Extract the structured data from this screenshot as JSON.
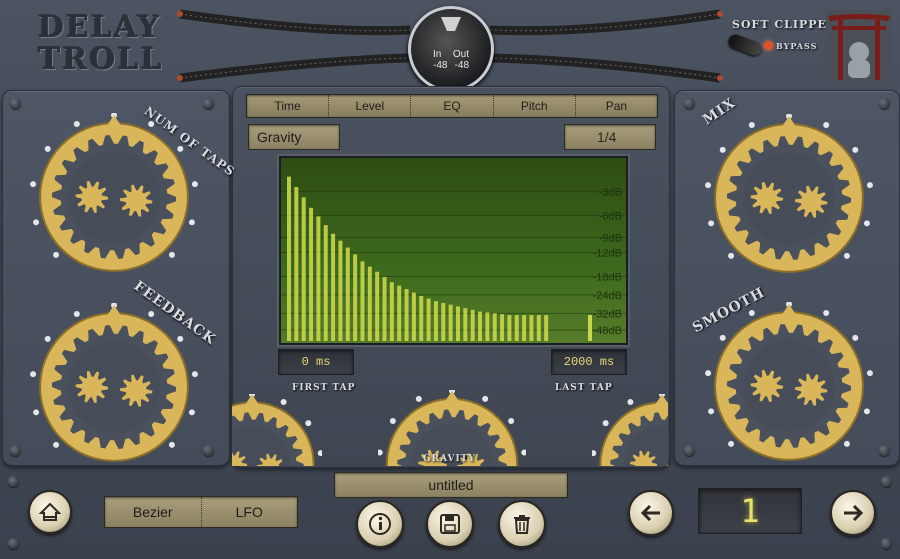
{
  "header": {
    "logo_line1": "DELAY",
    "logo_line2": "TROLL",
    "meter_in_label": "In",
    "meter_out_label": "Out",
    "meter_in_value": "-48",
    "meter_out_value": "-48"
  },
  "soft_clipper": {
    "label": "SOFT CLIPPER",
    "bypass_label": "BYPASS",
    "led_color": "#e0502a"
  },
  "tabs": [
    "Time",
    "Level",
    "EQ",
    "Pitch",
    "Pan"
  ],
  "preset_curve": "Gravity",
  "division": "1/4",
  "graph": {
    "db_labels": [
      "-3dB",
      "-6dB",
      "-9dB",
      "-12dB",
      "-18dB",
      "-24dB",
      "-32dB",
      "-48dB"
    ],
    "bar_levels": [
      0.95,
      0.89,
      0.83,
      0.77,
      0.72,
      0.67,
      0.62,
      0.58,
      0.54,
      0.5,
      0.46,
      0.43,
      0.4,
      0.37,
      0.34,
      0.32,
      0.3,
      0.28,
      0.26,
      0.245,
      0.23,
      0.22,
      0.21,
      0.2,
      0.19,
      0.18,
      0.17,
      0.165,
      0.16,
      0.155,
      0.15,
      0.15,
      0.15,
      0.15,
      0.15,
      0.15
    ],
    "bar_color": "#c9d64a"
  },
  "first_tap": {
    "value": "0 ms",
    "label": "FIRST TAP"
  },
  "last_tap": {
    "value": "2000 ms",
    "label": "LAST TAP"
  },
  "knobs": {
    "num_taps": "NUM OF TAPS",
    "feedback": "FEEDBACK",
    "mix": "MIX",
    "smooth": "SMOOTH",
    "gravity": "GRAVITY"
  },
  "bottom": {
    "curve_left": "Bezier",
    "curve_right": "LFO",
    "preset_name": "untitled",
    "preset_number": "1"
  },
  "icons": [
    "home-icon",
    "info-icon",
    "save-icon",
    "trash-icon",
    "arrow-left-icon",
    "arrow-right-icon"
  ]
}
